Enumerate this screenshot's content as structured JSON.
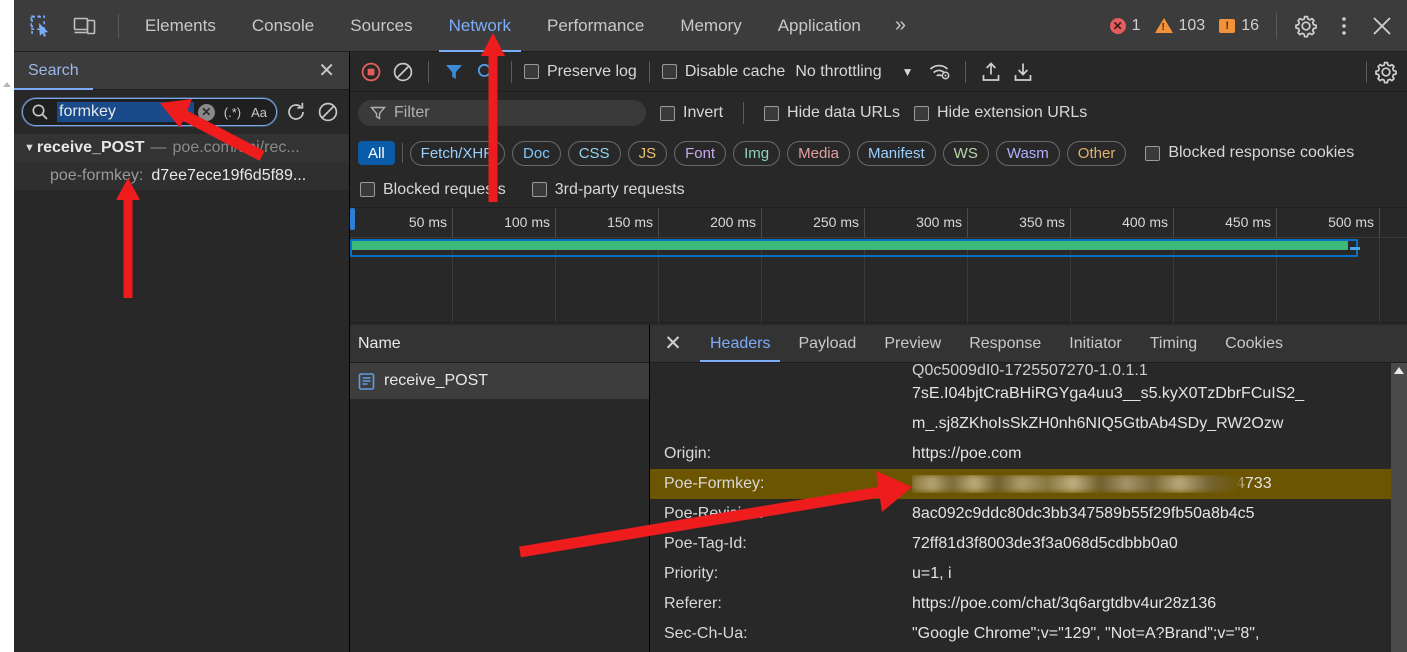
{
  "topbar": {
    "icons": [
      {
        "name": "inspect-element-icon",
        "label": "Inspect element"
      },
      {
        "name": "device-toolbar-icon",
        "label": "Toggle device toolbar"
      }
    ],
    "tabs": [
      {
        "label": "Elements",
        "active": false
      },
      {
        "label": "Console",
        "active": false
      },
      {
        "label": "Sources",
        "active": false
      },
      {
        "label": "Network",
        "active": true
      },
      {
        "label": "Performance",
        "active": false
      },
      {
        "label": "Memory",
        "active": false
      },
      {
        "label": "Application",
        "active": false
      }
    ],
    "more_label": "»",
    "counters": {
      "errors": "1",
      "warnings": "103",
      "infos": "16"
    },
    "settings_label": "Settings",
    "menu_label": "⋮",
    "close_label": "✕"
  },
  "search_pane": {
    "title": "Search",
    "close_label": "✕",
    "query": "formkey",
    "placeholder": "Search",
    "regex_label": "(.*)",
    "matchcase_label": "Aa",
    "refresh_label": "Refresh",
    "clear_label": "Clear",
    "results": [
      {
        "triangle": "▼",
        "file": "receive_POST",
        "dash": "—",
        "url": "poe.com/api/rec...",
        "match_key": "poe-formkey:",
        "match_value": "d7ee7ece19f6d5f89..."
      }
    ]
  },
  "network": {
    "toolbar": {
      "record_label": "Stop recording network log",
      "clear_label": "Clear network log",
      "filter_toggle_label": "Filter",
      "search_toggle_label": "Search",
      "preserve_log": "Preserve log",
      "disable_cache": "Disable cache",
      "throttling": "No throttling",
      "throttle_caret": "▼",
      "wifi_label": "Network conditions",
      "import_label": "Import HAR file",
      "export_label": "Export HAR file",
      "settings_label": "Network settings"
    },
    "filterbar": {
      "filter_placeholder": "Filter",
      "invert": "Invert",
      "hide_data_urls": "Hide data URLs",
      "hide_extension_urls": "Hide extension URLs"
    },
    "type_filters": [
      {
        "label": "All",
        "active": true,
        "color": "#ffffff"
      },
      {
        "label": "Fetch/XHR",
        "active": false,
        "color": "#9ad0ff"
      },
      {
        "label": "Doc",
        "active": false,
        "color": "#7fc8ff"
      },
      {
        "label": "CSS",
        "active": false,
        "color": "#8fd4f5"
      },
      {
        "label": "JS",
        "active": false,
        "color": "#e9c46a"
      },
      {
        "label": "Font",
        "active": false,
        "color": "#c9a7ef"
      },
      {
        "label": "Img",
        "active": false,
        "color": "#8fd4b8"
      },
      {
        "label": "Media",
        "active": false,
        "color": "#e4a0a0"
      },
      {
        "label": "Manifest",
        "active": false,
        "color": "#9ad0ff"
      },
      {
        "label": "WS",
        "active": false,
        "color": "#b7d7a8"
      },
      {
        "label": "Wasm",
        "active": false,
        "color": "#b0b0ff"
      },
      {
        "label": "Other",
        "active": false,
        "color": "#e0b070"
      }
    ],
    "extra_filters": {
      "blocked_response_cookies": "Blocked response cookies",
      "blocked_requests": "Blocked requests",
      "third_party_requests": "3rd-party requests"
    },
    "timeline": {
      "ticks": [
        "50 ms",
        "100 ms",
        "150 ms",
        "200 ms",
        "250 ms",
        "300 ms",
        "350 ms",
        "400 ms",
        "450 ms",
        "500 ms"
      ],
      "bar_color_download": "#3cb878",
      "bar_color_request": "#0b6fc4"
    },
    "request_list": {
      "column_header": "Name",
      "rows": [
        {
          "name": "receive_POST",
          "icon": "document-icon",
          "selected": true
        }
      ]
    }
  },
  "details": {
    "close_label": "✕",
    "tabs": [
      {
        "label": "Headers",
        "active": true
      },
      {
        "label": "Payload",
        "active": false
      },
      {
        "label": "Preview",
        "active": false
      },
      {
        "label": "Response",
        "active": false
      },
      {
        "label": "Initiator",
        "active": false
      },
      {
        "label": "Timing",
        "active": false
      },
      {
        "label": "Cookies",
        "active": false
      }
    ],
    "clipped_top_line": "Q0c5009dI0-1725507270-1.0.1.1",
    "wrapped_value_lines": [
      "7sE.I04bjtCraBHiRGYga4uu3__s5.kyX0TzDbrFCuIS2_",
      "m_.sj8ZKhoIsSkZH0nh6NIQ5GtbAb4SDy_RW2Ozw"
    ],
    "headers": [
      {
        "key": "Origin:",
        "value": "https://poe.com",
        "highlight": false,
        "blurred": false
      },
      {
        "key": "Poe-Formkey:",
        "value": "4733",
        "highlight": true,
        "blurred": true
      },
      {
        "key": "Poe-Revision:",
        "value": "8ac092c9ddc80dc3bb347589b55f29fb50a8b4c5",
        "highlight": false,
        "blurred": false
      },
      {
        "key": "Poe-Tag-Id:",
        "value": "72ff81d3f8003de3f3a068d5cdbbb0a0",
        "highlight": false,
        "blurred": false
      },
      {
        "key": "Priority:",
        "value": "u=1, i",
        "highlight": false,
        "blurred": false
      },
      {
        "key": "Referer:",
        "value": "https://poe.com/chat/3q6argtdbv4ur28z136",
        "highlight": false,
        "blurred": false
      },
      {
        "key": "Sec-Ch-Ua:",
        "value": "\"Google Chrome\";v=\"129\", \"Not=A?Brand\";v=\"8\",",
        "highlight": false,
        "blurred": false
      }
    ]
  },
  "annotations": {
    "arrow_to_searchbox": "red-arrow-pointing-to-search-field",
    "arrow_to_network_tab": "red-arrow-pointing-to-network-tab",
    "arrow_up_in_search_results": "red-arrow-pointing-up-at-search-results",
    "arrow_to_formkey_value": "red-arrow-pointing-to-poe-formkey-value",
    "color": "#ee1c1c"
  }
}
